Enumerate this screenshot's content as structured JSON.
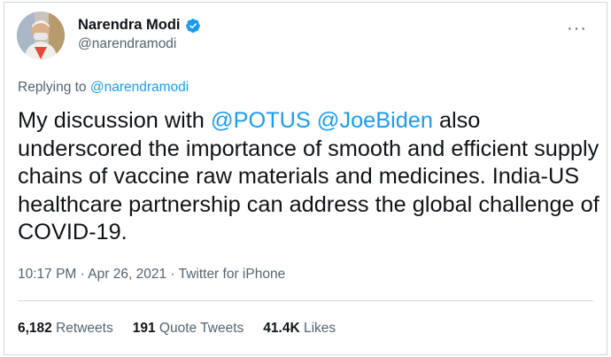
{
  "author": {
    "display_name": "Narendra Modi",
    "handle": "@narendramodi",
    "verified": true
  },
  "reply": {
    "prefix": "Replying to ",
    "mention": "@narendramodi"
  },
  "tweet": {
    "part1": "My discussion with ",
    "mention1": "@POTUS",
    "space": " ",
    "mention2": "@JoeBiden",
    "part2": " also underscored the importance of smooth and efficient supply chains of vaccine raw materials and medicines. India-US healthcare partnership can address the global challenge of COVID-19."
  },
  "meta": {
    "time": "10:17 PM",
    "separator": "·",
    "date": "Apr 26, 2021",
    "source": "Twitter for iPhone"
  },
  "stats": {
    "retweets_count": "6,182",
    "retweets_label": "Retweets",
    "quotes_count": "191",
    "quotes_label": "Quote Tweets",
    "likes_count": "41.4K",
    "likes_label": "Likes"
  },
  "more_icon": "more-horizontal-icon",
  "colors": {
    "accent": "#1d9bf0",
    "muted": "#536471",
    "text": "#0f1419"
  }
}
